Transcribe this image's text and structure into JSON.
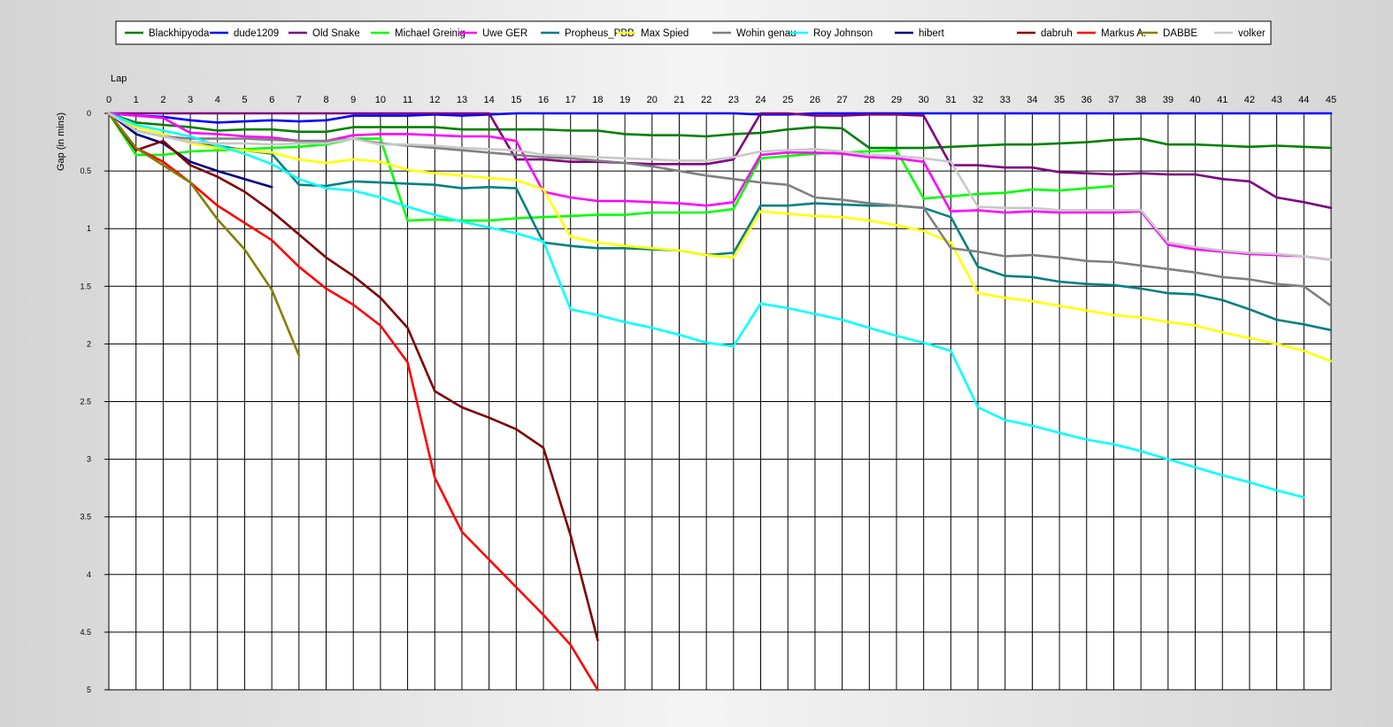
{
  "chart_data": {
    "type": "line",
    "xlabel": "Lap",
    "ylabel": "Gap (in mins)",
    "xlim": [
      0,
      45
    ],
    "ylim": [
      0,
      5
    ],
    "y_inverted": true,
    "x_ticks": [
      0,
      1,
      2,
      3,
      4,
      5,
      6,
      7,
      8,
      9,
      10,
      11,
      12,
      13,
      14,
      15,
      16,
      17,
      18,
      19,
      20,
      21,
      22,
      23,
      24,
      25,
      26,
      27,
      28,
      29,
      30,
      31,
      32,
      33,
      34,
      35,
      36,
      37,
      38,
      39,
      40,
      41,
      42,
      43,
      44,
      45
    ],
    "y_ticks": [
      "0",
      "0.5",
      "1",
      "1.5",
      "2",
      "2.5",
      "3",
      "3.5",
      "4",
      "4.5",
      "5"
    ],
    "grid": true,
    "legend_position": "top",
    "series": [
      {
        "name": "Blackhipyoda",
        "color": "#008000",
        "values": [
          0,
          0.08,
          0.1,
          0.12,
          0.15,
          0.14,
          0.14,
          0.16,
          0.16,
          0.12,
          0.12,
          0.12,
          0.12,
          0.14,
          0.14,
          0.14,
          0.14,
          0.15,
          0.15,
          0.18,
          0.19,
          0.19,
          0.2,
          0.18,
          0.17,
          0.14,
          0.12,
          0.13,
          0.3,
          0.3,
          0.3,
          0.29,
          0.28,
          0.27,
          0.27,
          0.26,
          0.25,
          0.23,
          0.22,
          0.27,
          0.27,
          0.28,
          0.29,
          0.28,
          0.29,
          0.3
        ]
      },
      {
        "name": "dude1209",
        "color": "#0000ff",
        "values": [
          0,
          0.02,
          0.03,
          0.06,
          0.08,
          0.07,
          0.06,
          0.07,
          0.06,
          0.02,
          0.02,
          0.02,
          0.01,
          0.02,
          0.01,
          0,
          0,
          0,
          0,
          0,
          0,
          0,
          0,
          0,
          0.01,
          0.01,
          0,
          0,
          0,
          0,
          0,
          0,
          0,
          0,
          0,
          0,
          0,
          0,
          0,
          0,
          0,
          0,
          0,
          0,
          0,
          0
        ]
      },
      {
        "name": "Old Snake",
        "color": "#800080",
        "values": [
          0,
          0,
          0,
          0,
          0,
          0,
          0,
          0,
          0,
          0,
          0,
          0,
          0,
          0,
          0,
          0.4,
          0.4,
          0.42,
          0.42,
          0.43,
          0.44,
          0.44,
          0.44,
          0.4,
          0,
          0,
          0.02,
          0.02,
          0.01,
          0.01,
          0.02,
          0.45,
          0.45,
          0.47,
          0.47,
          0.51,
          0.52,
          0.53,
          0.52,
          0.53,
          0.53,
          0.57,
          0.59,
          0.73,
          0.77,
          0.82
        ]
      },
      {
        "name": "Michael Greinig",
        "color": "#00ff00",
        "values": [
          0,
          0.36,
          0.36,
          0.33,
          0.32,
          0.31,
          0.3,
          0.29,
          0.27,
          0.22,
          0.22,
          0.93,
          0.92,
          0.93,
          0.93,
          0.91,
          0.9,
          0.89,
          0.88,
          0.88,
          0.86,
          0.86,
          0.86,
          0.83,
          0.39,
          0.37,
          0.35,
          0.34,
          0.33,
          0.32,
          0.74,
          0.72,
          0.7,
          0.69,
          0.66,
          0.67,
          0.65,
          0.63
        ]
      },
      {
        "name": "Uwe GER",
        "color": "#ff00ff",
        "values": [
          0,
          0.02,
          0.04,
          0.17,
          0.18,
          0.2,
          0.21,
          0.24,
          0.24,
          0.19,
          0.18,
          0.18,
          0.19,
          0.2,
          0.2,
          0.24,
          0.68,
          0.73,
          0.76,
          0.76,
          0.77,
          0.78,
          0.8,
          0.77,
          0.36,
          0.34,
          0.34,
          0.35,
          0.38,
          0.39,
          0.42,
          0.85,
          0.84,
          0.86,
          0.85,
          0.86,
          0.86,
          0.86,
          0.85,
          1.14,
          1.18,
          1.2,
          1.22,
          1.23,
          1.24,
          1.27
        ]
      },
      {
        "name": "Propheus_PBB",
        "color": "#008080",
        "values": [
          0,
          0.15,
          0.2,
          0.25,
          0.28,
          0.32,
          0.35,
          0.62,
          0.63,
          0.59,
          0.6,
          0.61,
          0.62,
          0.65,
          0.64,
          0.65,
          1.12,
          1.15,
          1.17,
          1.17,
          1.18,
          1.19,
          1.23,
          1.21,
          0.8,
          0.8,
          0.78,
          0.79,
          0.8,
          0.8,
          0.82,
          0.9,
          1.33,
          1.41,
          1.42,
          1.46,
          1.48,
          1.49,
          1.52,
          1.56,
          1.57,
          1.62,
          1.7,
          1.79,
          1.83,
          1.88
        ]
      },
      {
        "name": "Max Spied",
        "color": "#ffff00",
        "values": [
          0,
          0.12,
          0.18,
          0.26,
          0.3,
          0.32,
          0.34,
          0.4,
          0.43,
          0.4,
          0.42,
          0.49,
          0.52,
          0.54,
          0.56,
          0.58,
          0.66,
          1.07,
          1.12,
          1.15,
          1.17,
          1.19,
          1.23,
          1.25,
          0.85,
          0.87,
          0.89,
          0.9,
          0.93,
          0.97,
          1.02,
          1.12,
          1.56,
          1.6,
          1.63,
          1.67,
          1.71,
          1.75,
          1.77,
          1.81,
          1.84,
          1.9,
          1.95,
          2.0,
          2.06,
          2.15
        ]
      },
      {
        "name": "Wohin genau",
        "color": "#808080",
        "values": [
          0,
          0.15,
          0.2,
          0.22,
          0.22,
          0.22,
          0.23,
          0.24,
          0.24,
          0.22,
          0.26,
          0.28,
          0.3,
          0.32,
          0.34,
          0.36,
          0.38,
          0.39,
          0.41,
          0.43,
          0.46,
          0.5,
          0.54,
          0.57,
          0.6,
          0.62,
          0.73,
          0.75,
          0.78,
          0.8,
          0.82,
          1.17,
          1.2,
          1.24,
          1.23,
          1.25,
          1.28,
          1.29,
          1.32,
          1.35,
          1.38,
          1.42,
          1.44,
          1.48,
          1.5,
          1.67
        ]
      },
      {
        "name": "Roy Johnson",
        "color": "#00ffff",
        "values": [
          0,
          0.1,
          0.15,
          0.2,
          0.28,
          0.35,
          0.44,
          0.57,
          0.65,
          0.67,
          0.73,
          0.81,
          0.88,
          0.94,
          0.99,
          1.04,
          1.11,
          1.7,
          1.75,
          1.81,
          1.86,
          1.92,
          1.99,
          2.02,
          1.65,
          1.69,
          1.74,
          1.79,
          1.86,
          1.93,
          1.99,
          2.06,
          2.55,
          2.66,
          2.71,
          2.77,
          2.83,
          2.87,
          2.93,
          3.0,
          3.07,
          3.14,
          3.2,
          3.27,
          3.33
        ]
      },
      {
        "name": "hibert",
        "color": "#000080",
        "values": [
          0,
          0.18,
          0.26,
          0.42,
          0.5,
          0.57,
          0.64
        ]
      },
      {
        "name": "dabruh",
        "color": "#800000",
        "values": [
          0,
          0.32,
          0.24,
          0.45,
          0.55,
          0.68,
          0.85,
          1.05,
          1.25,
          1.41,
          1.6,
          1.86,
          2.41,
          2.55,
          2.64,
          2.74,
          2.9,
          3.66,
          4.57
        ]
      },
      {
        "name": "Markus A.",
        "color": "#ff0000",
        "values": [
          0,
          0.3,
          0.42,
          0.6,
          0.8,
          0.95,
          1.1,
          1.33,
          1.52,
          1.66,
          1.84,
          2.16,
          3.16,
          3.63,
          3.87,
          4.11,
          4.35,
          4.61,
          5.0
        ]
      },
      {
        "name": "DABBE",
        "color": "#808000",
        "values": [
          0,
          0.3,
          0.45,
          0.6,
          0.92,
          1.18,
          1.53,
          2.1
        ]
      },
      {
        "name": "volker",
        "color": "#c8c8c8",
        "values": [
          0,
          0.15,
          0.2,
          0.25,
          0.26,
          0.26,
          0.27,
          0.26,
          0.26,
          0.22,
          0.27,
          0.27,
          0.28,
          0.3,
          0.31,
          0.32,
          0.36,
          0.37,
          0.38,
          0.39,
          0.4,
          0.41,
          0.41,
          0.38,
          0.33,
          0.32,
          0.31,
          0.33,
          0.36,
          0.37,
          0.39,
          0.42,
          0.81,
          0.82,
          0.82,
          0.84,
          0.84,
          0.84,
          0.84,
          1.12,
          1.16,
          1.19,
          1.21,
          1.22,
          1.24,
          1.27
        ]
      }
    ]
  }
}
